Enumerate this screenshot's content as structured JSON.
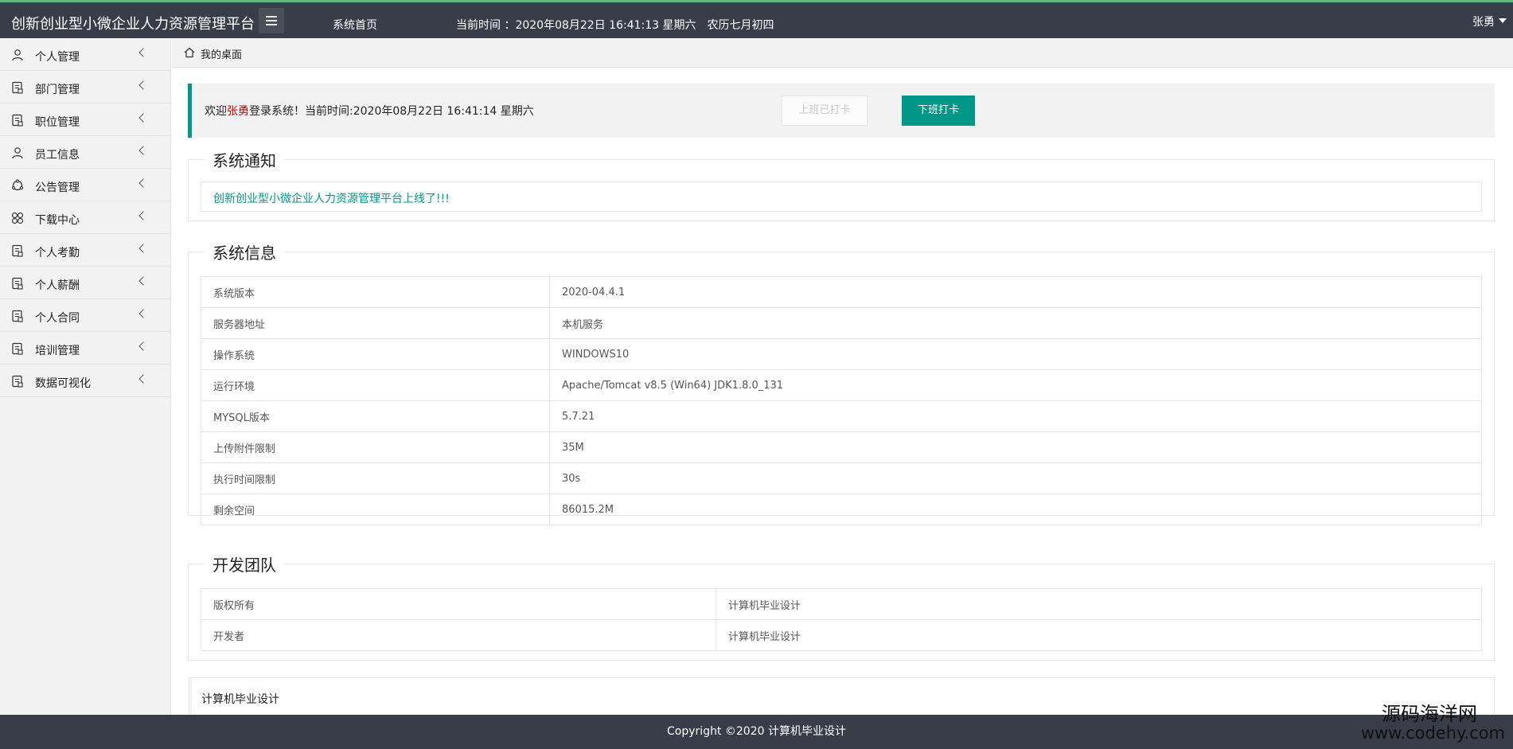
{
  "header": {
    "title": "创新创业型小微企业人力资源管理平台",
    "nav_home": "系统首页",
    "clock_label": "当前时间 ：2020年08月22日 16:41:13 星期六",
    "lunar": "农历七月初四",
    "user": "张勇"
  },
  "sidebar": {
    "items": [
      {
        "label": "个人管理",
        "icon": "user-icon"
      },
      {
        "label": "部门管理",
        "icon": "file-icon"
      },
      {
        "label": "职位管理",
        "icon": "file-icon"
      },
      {
        "label": "员工信息",
        "icon": "user-icon"
      },
      {
        "label": "公告管理",
        "icon": "circle-icon"
      },
      {
        "label": "下载中心",
        "icon": "grid-icon"
      },
      {
        "label": "个人考勤",
        "icon": "file-icon"
      },
      {
        "label": "个人薪酬",
        "icon": "file-icon"
      },
      {
        "label": "个人合同",
        "icon": "file-icon"
      },
      {
        "label": "培训管理",
        "icon": "file-icon"
      },
      {
        "label": "数据可视化",
        "icon": "file-icon"
      }
    ]
  },
  "breadcrumb": {
    "label": "我的桌面"
  },
  "welcome": {
    "prefix": "欢迎",
    "name": "张勇",
    "suffix": "登录系统！当前时间:2020年08月22日 16:41:14 星期六",
    "checkin_label": "上班已打卡",
    "checkout_label": "下班打卡"
  },
  "notice": {
    "title": "系统通知",
    "text": "创新创业型小微企业人力资源管理平台上线了!!!"
  },
  "sysinfo": {
    "title": "系统信息",
    "rows": [
      {
        "k": "系统版本",
        "v": "2020-04.4.1"
      },
      {
        "k": "服务器地址",
        "v": "本机服务"
      },
      {
        "k": "操作系统",
        "v": "WINDOWS10"
      },
      {
        "k": "运行环境",
        "v": "Apache/Tomcat v8.5 (Win64) JDK1.8.0_131"
      },
      {
        "k": "MYSQL版本",
        "v": "5.7.21"
      },
      {
        "k": "上传附件限制",
        "v": "35M"
      },
      {
        "k": "执行时间限制",
        "v": "30s"
      },
      {
        "k": "剩余空间",
        "v": "86015.2M"
      }
    ]
  },
  "team": {
    "title": "开发团队",
    "rows": [
      {
        "k": "版权所有",
        "v": "计算机毕业设计"
      },
      {
        "k": "开发者",
        "v": "计算机毕业设计"
      }
    ]
  },
  "bottom_panel": {
    "title": "计算机毕业设计"
  },
  "footer": {
    "text": "Copyright ©2020 计算机毕业设计"
  },
  "watermark": {
    "line1": "源码海洋网",
    "line2": "www.codehy.com"
  },
  "colors": {
    "topbar": "#393d49",
    "accent": "#009688",
    "name_red": "#cc0000"
  }
}
